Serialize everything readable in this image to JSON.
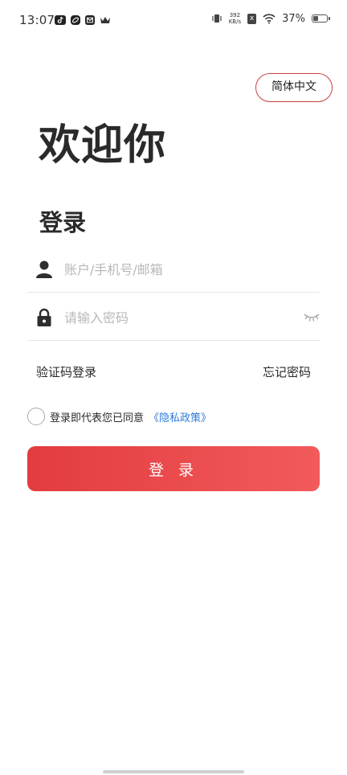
{
  "status_bar": {
    "time": "13:07",
    "net_speed_value": "392",
    "net_speed_unit": "KB/s",
    "sim_badge": "x",
    "battery_percent": "37%",
    "battery_level": 0.37,
    "left_icons": [
      "tiktok-icon",
      "app-icon",
      "message-icon",
      "crown-icon"
    ],
    "right_icons": [
      "vibrate-icon",
      "sim-x-icon",
      "wifi-icon",
      "battery-icon"
    ]
  },
  "header": {
    "language_button": "简体中文"
  },
  "welcome": {
    "title": "欢迎你",
    "subtitle": "登录"
  },
  "form": {
    "account_placeholder": "账户/手机号/邮箱",
    "password_placeholder": "请输入密码",
    "sms_login_link": "验证码登录",
    "forgot_password_link": "忘记密码",
    "agree_text": "登录即代表您已同意",
    "policy_link": "《隐私政策》",
    "login_button": "登 录"
  },
  "colors": {
    "accent": "#e23c3f",
    "accent_light": "#f25a5c",
    "link_blue": "#2f7bd8",
    "lang_border": "#c94040"
  }
}
